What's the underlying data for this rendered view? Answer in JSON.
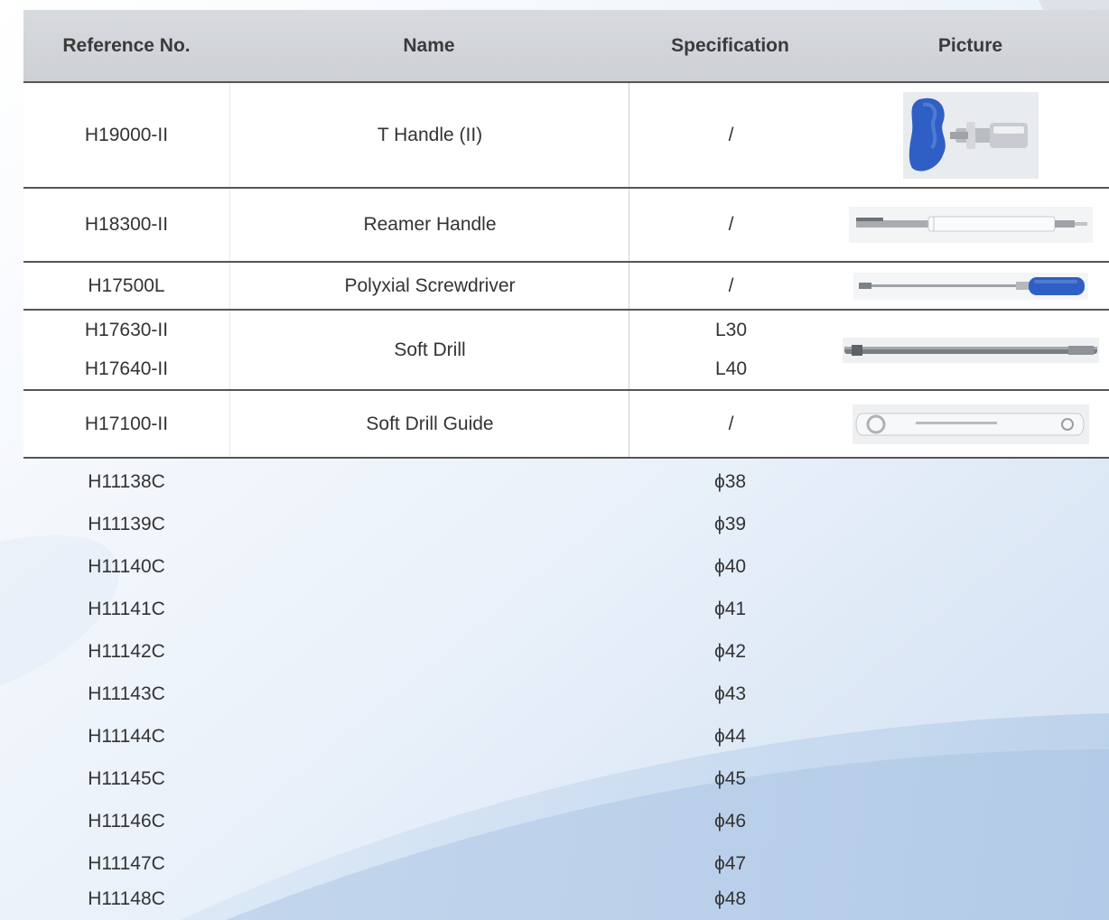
{
  "table": {
    "headers": {
      "reference": "Reference No.",
      "name": "Name",
      "specification": "Specification",
      "picture": "Picture"
    },
    "rows": [
      {
        "ref": "H19000-II",
        "name": "T Handle (II)",
        "spec": "/",
        "picture_icon": "t-handle-icon"
      },
      {
        "ref": "H18300-II",
        "name": "Reamer Handle",
        "spec": "/",
        "picture_icon": "reamer-handle-icon"
      },
      {
        "ref": "H17500L",
        "name": "Polyxial Screwdriver",
        "spec": "/",
        "picture_icon": "screwdriver-icon"
      },
      {
        "refs": [
          "H17630-II",
          "H17640-II"
        ],
        "name": "Soft Drill",
        "specs": [
          "L30",
          "L40"
        ],
        "picture_icon": "soft-drill-icon"
      },
      {
        "ref": "H17100-II",
        "name": "Soft Drill Guide",
        "spec": "/",
        "picture_icon": "drill-guide-icon"
      }
    ],
    "plain_rows": [
      {
        "ref": "H11138C",
        "spec": "ϕ38"
      },
      {
        "ref": "H11139C",
        "spec": "ϕ39"
      },
      {
        "ref": "H11140C",
        "spec": "ϕ40"
      },
      {
        "ref": "H11141C",
        "spec": "ϕ41"
      },
      {
        "ref": "H11142C",
        "spec": "ϕ42"
      },
      {
        "ref": "H11143C",
        "spec": "ϕ43"
      },
      {
        "ref": "H11144C",
        "spec": "ϕ44"
      },
      {
        "ref": "H11145C",
        "spec": "ϕ45"
      },
      {
        "ref": "H11146C",
        "spec": "ϕ46"
      },
      {
        "ref": "H11147C",
        "spec": "ϕ47"
      },
      {
        "ref": "H11148C",
        "spec": "ϕ48"
      }
    ]
  },
  "colors": {
    "header_bg": "#d2d5d9",
    "rule": "#555555",
    "accent_blue": "#2f5fc4"
  }
}
